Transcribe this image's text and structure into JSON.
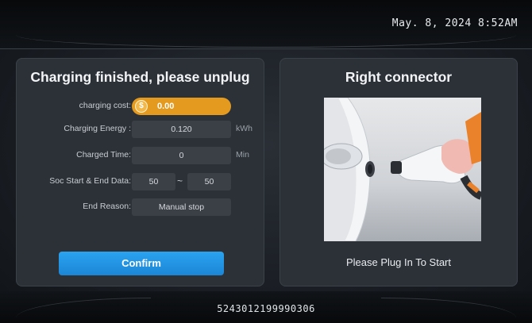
{
  "header": {
    "datetime": "May. 8, 2024  8:52AM"
  },
  "left_panel": {
    "title": "Charging finished, please unplug",
    "charging_cost": {
      "label": "charging cost:",
      "value": "0.00",
      "icon": "coin-icon"
    },
    "charging_energy": {
      "label": "Charging Energy :",
      "value": "0.120",
      "unit": "kWh"
    },
    "charged_time": {
      "label": "Charged Time:",
      "value": "0",
      "unit": "Min"
    },
    "soc": {
      "label": "Soc Start & End Data:",
      "start": "50",
      "separator": "~",
      "end": "50"
    },
    "end_reason": {
      "label": "End Reason:",
      "value": "Manual stop"
    },
    "confirm_label": "Confirm"
  },
  "right_panel": {
    "title": "Right connector",
    "caption": "Please Plug In To Start"
  },
  "footer": {
    "serial": "5243012199990306"
  },
  "colors": {
    "accent_blue": "#1c86d6",
    "cost_orange": "#e39a1f",
    "panel_bg": "#2c3138"
  }
}
